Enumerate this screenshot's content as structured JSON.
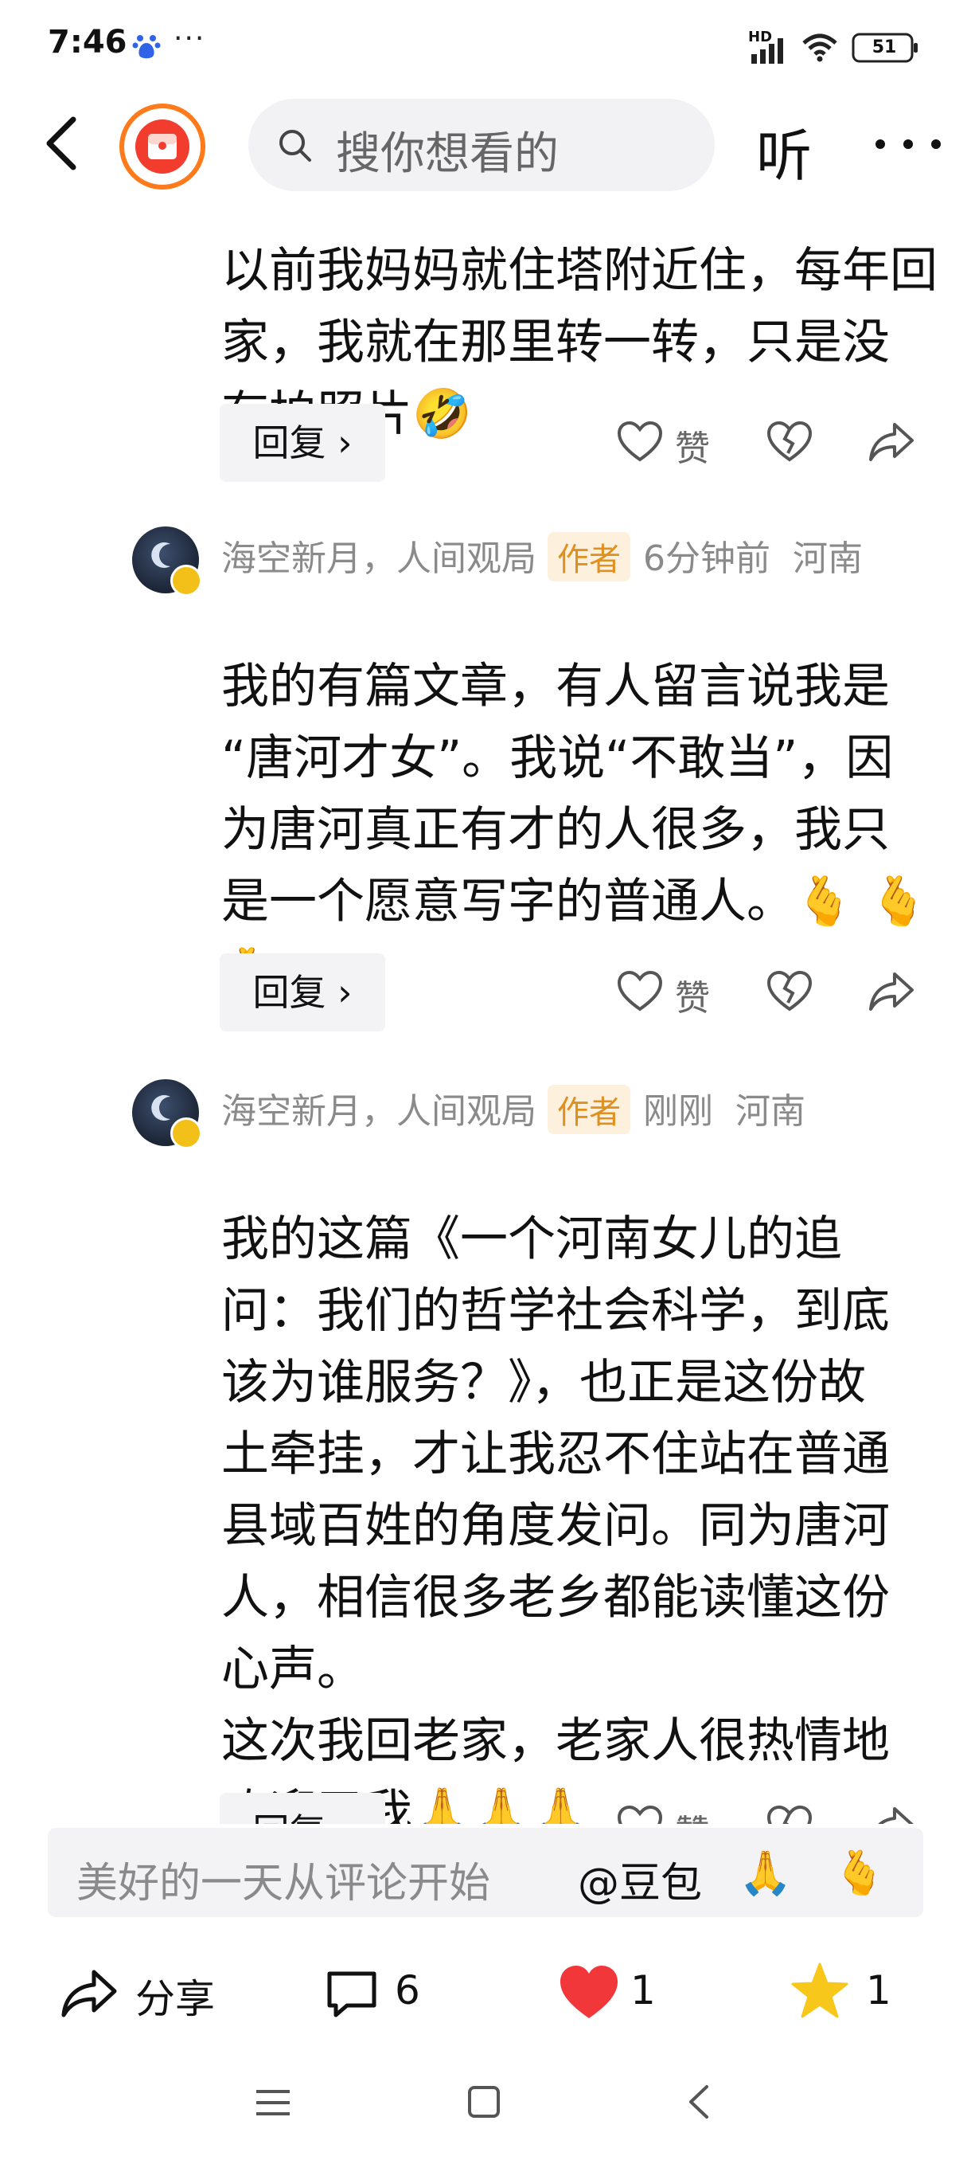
{
  "status_bar": {
    "time": "7:46",
    "more": "···",
    "network": "HD",
    "battery": "51"
  },
  "nav": {
    "search_placeholder": "搜你想看的",
    "listen_label": "听"
  },
  "comments": [
    {
      "partial": true,
      "text": "以前我妈妈就住塔附近住，每年回\n家，我就在那里转一转，只是没\n有拍照片",
      "emoji": "🤣",
      "reply_label": "回复 ›",
      "like_label": "赞"
    },
    {
      "author": "海空新月，人间观局",
      "tag": "作者",
      "time": "6分钟前",
      "location": "河南",
      "text": "我的有篇文章，有人留言说我是\n“唐河才女”。我说“不敢当”，因\n为唐河真正有才的人很多，我只\n是一个愿意写字的普通人。",
      "emoji": "🫰 🫰🫰",
      "reply_label": "回复 ›",
      "like_label": "赞"
    },
    {
      "author": "海空新月，人间观局",
      "tag": "作者",
      "time": "刚刚",
      "location": "河南",
      "text": "我的这篇《一个河南女儿的追\n问：我们的哲学社会科学，到底\n该为谁服务？》，也正是这份故\n土牵挂，才让我忍不住站在普通\n县域百姓的角度发问。同为唐河\n人，相信很多老乡都能读懂这份\n心声。\n这次我回老家，老家人很热情地\n欢迎了我",
      "emoji": "🙏🙏🙏",
      "reply_label": "回复 ›",
      "like_label": "赞"
    }
  ],
  "comment_bar": {
    "placeholder": "美好的一天从评论开始",
    "mention": "@豆包",
    "emoji_1": "🙏",
    "emoji_2": "🫰"
  },
  "actions": {
    "share_label": "分享",
    "comment_count": "6",
    "like_count": "1",
    "star_count": "1"
  },
  "colors": {
    "author_tag_bg": "#fdf0dc",
    "author_tag_text": "#e0901e",
    "like_red": "#f2373a",
    "star_yellow": "#f7c71b",
    "avatar_ring": "#ff7a1a"
  }
}
